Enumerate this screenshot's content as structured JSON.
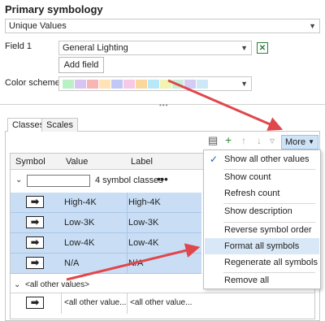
{
  "header": {
    "title": "Primary symbology",
    "renderer": "Unique Values"
  },
  "field1": {
    "label": "Field 1",
    "value": "General Lighting",
    "add_field": "Add field"
  },
  "color_scheme": {
    "label": "Color scheme",
    "colors": [
      "#b9f0c6",
      "#d7c4f0",
      "#f7b5b5",
      "#fde3b5",
      "#c2c8f5",
      "#f8c9e6",
      "#fbd7a0",
      "#b8e8f8",
      "#f1f4b4",
      "#c7f0d8",
      "#d5ccf3",
      "#cfe8f7"
    ]
  },
  "tabs": [
    {
      "label": "Classes"
    },
    {
      "label": "Scales"
    }
  ],
  "toolbar": {
    "more_label": "More"
  },
  "grid": {
    "columns": [
      "Symbol",
      "Value",
      "Label"
    ],
    "class_count": "4 symbol classes",
    "rows": [
      {
        "value": "High-4K",
        "label": "High-4K"
      },
      {
        "value": "Low-3K",
        "label": "Low-3K"
      },
      {
        "value": "Low-4K",
        "label": "Low-4K"
      },
      {
        "value": "N/A",
        "label": "N/A"
      }
    ],
    "other_group": "<all other values>",
    "other_row": {
      "value": "<all other value...",
      "label": "<all other value..."
    }
  },
  "menu": {
    "items": [
      {
        "label": "Show all other values",
        "checked": true
      },
      {
        "label": "Show count"
      },
      {
        "label": "Refresh count"
      },
      {
        "label": "Show description"
      },
      {
        "label": "Reverse symbol order"
      },
      {
        "label": "Format all symbols",
        "highlighted": true
      },
      {
        "label": "Regenerate all symbols"
      },
      {
        "label": "Remove all"
      }
    ]
  },
  "colors": {
    "arrow": "#e0474c",
    "selection": "#c9def5",
    "more_button": "#cfe3f7"
  }
}
